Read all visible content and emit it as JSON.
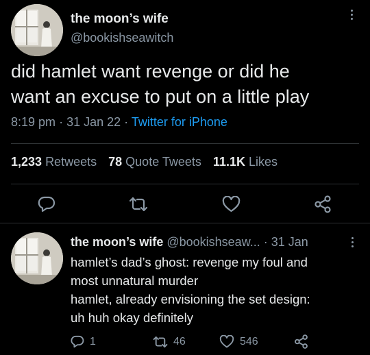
{
  "main_tweet": {
    "display_name": "the moon’s wife",
    "handle": "@bookishseawitch",
    "text_line1": "did hamlet want revenge or did he",
    "text_line2": "want an excuse to put on a little play",
    "time": "8:19 pm",
    "date": "31 Jan 22",
    "source": "Twitter for iPhone",
    "retweets_count": "1,233",
    "retweets_label": "Retweets",
    "quotes_count": "78",
    "quotes_label": "Quote Tweets",
    "likes_count": "11.1K",
    "likes_label": "Likes"
  },
  "reply": {
    "display_name": "the moon’s wife",
    "handle": "@bookishseaw...",
    "date": "31 Jan",
    "line1": "hamlet’s dad’s ghost: revenge my foul and",
    "line2": "most unnatural murder",
    "line3": "hamlet, already envisioning the set design:",
    "line4": "uh huh okay definitely",
    "replies": "1",
    "retweets": "46",
    "likes": "546"
  },
  "separator": "·",
  "icons": [
    "more-icon",
    "reply-icon",
    "retweet-icon",
    "like-icon",
    "share-icon"
  ],
  "colors": {
    "background": "#000000",
    "text": "#e7e9ea",
    "muted": "#8b98a5",
    "link": "#1d9bf0",
    "divider": "#2f3336"
  }
}
